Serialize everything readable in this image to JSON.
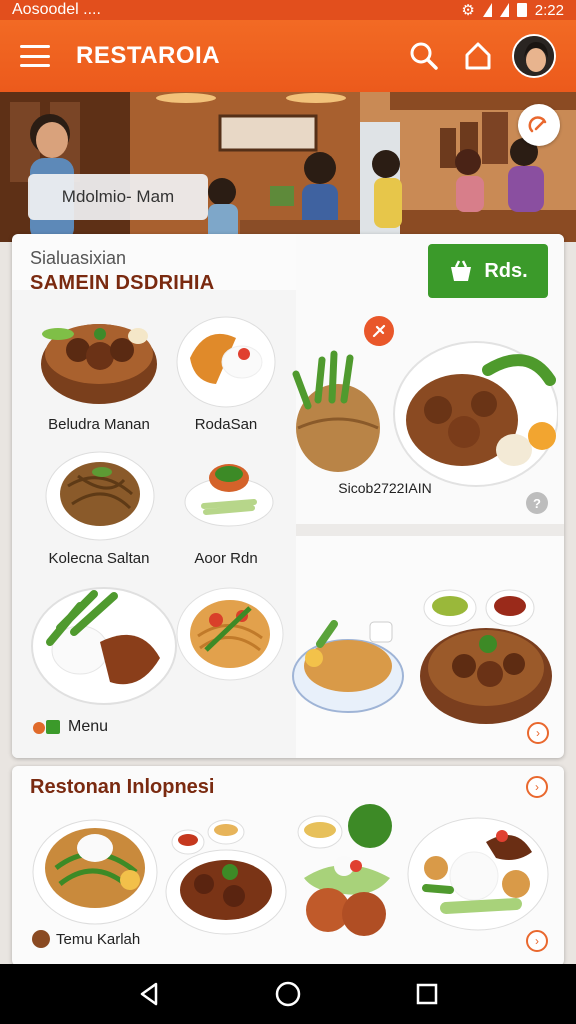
{
  "status_bar": {
    "left_text": "Aosoodel  ....",
    "time": "2:22"
  },
  "app_bar": {
    "title": "RESTAROIA"
  },
  "hero": {
    "label": "Mdolmio- Mam"
  },
  "main_card": {
    "subtitle": "Sialuasixian",
    "title": "SAMEIN DSDRIHIA",
    "cta_label": "Rds.",
    "dishes": [
      {
        "name": "Beludra Manan"
      },
      {
        "name": "RodaSan"
      },
      {
        "name": "Kolecna Saltan"
      },
      {
        "name": "Aoor Rdn"
      }
    ],
    "featured_caption": "Sicob2722IAIN",
    "menu_link": "Menu"
  },
  "lower_card": {
    "title": "Restonan Inlopnesi",
    "footer_label": "Temu Karlah"
  },
  "colors": {
    "accent": "#ec5a1c",
    "cta": "#3b9a2a",
    "title_brown": "#7a2a10"
  },
  "icons": [
    "hamburger-icon",
    "search-icon",
    "home-icon",
    "edit-icon",
    "basket-icon",
    "pin-icon",
    "back-icon",
    "home-circle-icon",
    "recents-icon"
  ]
}
